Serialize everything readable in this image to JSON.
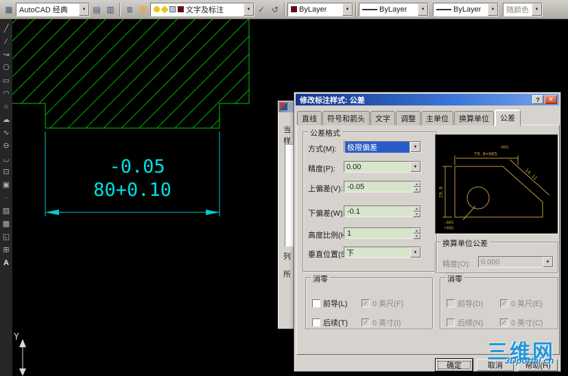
{
  "toolbar": {
    "workspace_combo": "AutoCAD 经典",
    "layer_combo": "文字及标注",
    "color_combo": "ByLayer",
    "linetype_combo": "ByLayer",
    "lineweight_combo": "ByLayer",
    "plotstyle_combo": "随颜色"
  },
  "left_toolbar": {
    "icons": [
      {
        "name": "line",
        "glyph": "╱"
      },
      {
        "name": "construction-line",
        "glyph": "∕"
      },
      {
        "name": "polyline",
        "glyph": "↝"
      },
      {
        "name": "polygon",
        "glyph": "⎔"
      },
      {
        "name": "rectangle",
        "glyph": "▭"
      },
      {
        "name": "arc",
        "glyph": "◠"
      },
      {
        "name": "circle",
        "glyph": "○"
      },
      {
        "name": "revision-cloud",
        "glyph": "☁"
      },
      {
        "name": "spline",
        "glyph": "∿"
      },
      {
        "name": "ellipse",
        "glyph": "⊖"
      },
      {
        "name": "ellipse-arc",
        "glyph": "◡"
      },
      {
        "name": "insert-block",
        "glyph": "⊡"
      },
      {
        "name": "make-block",
        "glyph": "▣"
      },
      {
        "name": "point",
        "glyph": "∙"
      },
      {
        "name": "hatch",
        "glyph": "▨"
      },
      {
        "name": "gradient",
        "glyph": "▩"
      },
      {
        "name": "region",
        "glyph": "◱"
      },
      {
        "name": "table",
        "glyph": "⊞"
      },
      {
        "name": "mtext",
        "glyph": "A"
      }
    ]
  },
  "canvas": {
    "dim_upper": "-0.05",
    "dim_main": "80+0.10",
    "ucs_axis": "Y"
  },
  "back_dialog": {
    "labels": [
      "当",
      "样",
      "列",
      "所"
    ]
  },
  "dialog": {
    "title": "修改标注样式: 公差",
    "help_button": "?",
    "close_button": "✕",
    "tabs": [
      "直线",
      "符号和箭头",
      "文字",
      "调整",
      "主单位",
      "换算单位",
      "公差"
    ],
    "tolerance_format": {
      "legend": "公差格式",
      "method_label": "方式(M):",
      "method_value": "极限偏差",
      "precision_label": "精度(P):",
      "precision_value": "0.00",
      "upper_label": "上偏差(V):",
      "upper_value": "-0.05",
      "lower_label": "下偏差(W):",
      "lower_value": "-0.1",
      "height_label": "高度比例(H):",
      "height_value": "1",
      "vertical_label": "垂直位置(S):",
      "vertical_value": "下"
    },
    "preview": {
      "top_dev": "-005",
      "top_dim": "79.0+005",
      "left_dim": "29.0",
      "diag_dim": "14.11",
      "bot_dev_minus": "-005",
      "bot_dev_plus": "+005"
    },
    "alt_tolerance": {
      "legend": "换算单位公差",
      "precision_label": "精度(O):",
      "precision_value": "0.000"
    },
    "zero_main": {
      "legend": "消零",
      "leading": "前导(L)",
      "trailing": "后续(T)",
      "feet": "0 英尺(F)",
      "inches": "0 英寸(I)",
      "check": "✓"
    },
    "zero_alt": {
      "legend": "消零",
      "leading": "前导(D)",
      "trailing": "后续(N)",
      "feet": "0 英尺(E)",
      "inches": "0 英寸(C)",
      "check": "✓"
    },
    "buttons": {
      "ok": "确定",
      "cancel": "取消",
      "help": "帮助(H)"
    }
  },
  "watermark": {
    "title": "三维网",
    "subtitle": "3Dportal.cn"
  }
}
